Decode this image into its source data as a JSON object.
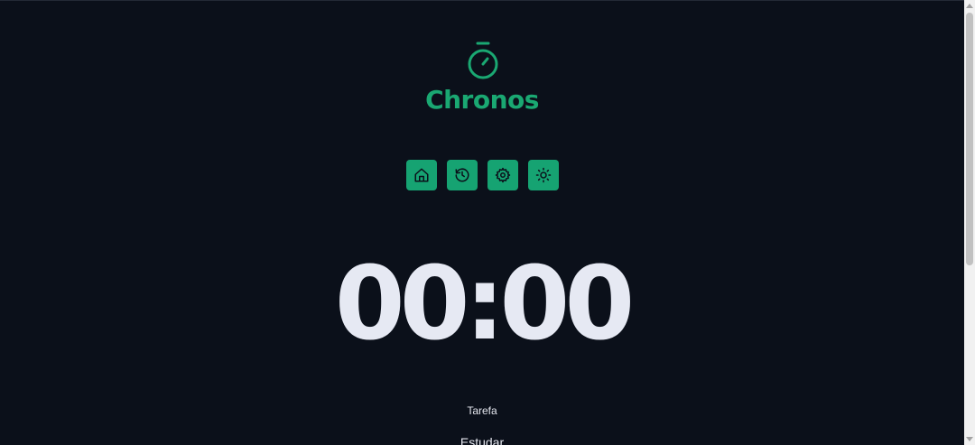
{
  "app": {
    "title": "Chronos",
    "logo_icon": "stopwatch-icon",
    "accent_color": "#1aa872",
    "background_color": "#0b101a"
  },
  "nav": {
    "buttons": [
      {
        "icon": "home-icon"
      },
      {
        "icon": "history-icon"
      },
      {
        "icon": "gear-icon"
      },
      {
        "icon": "sun-icon"
      }
    ]
  },
  "timer": {
    "display": "00:00"
  },
  "task": {
    "label": "Tarefa",
    "value": "Estudar"
  }
}
